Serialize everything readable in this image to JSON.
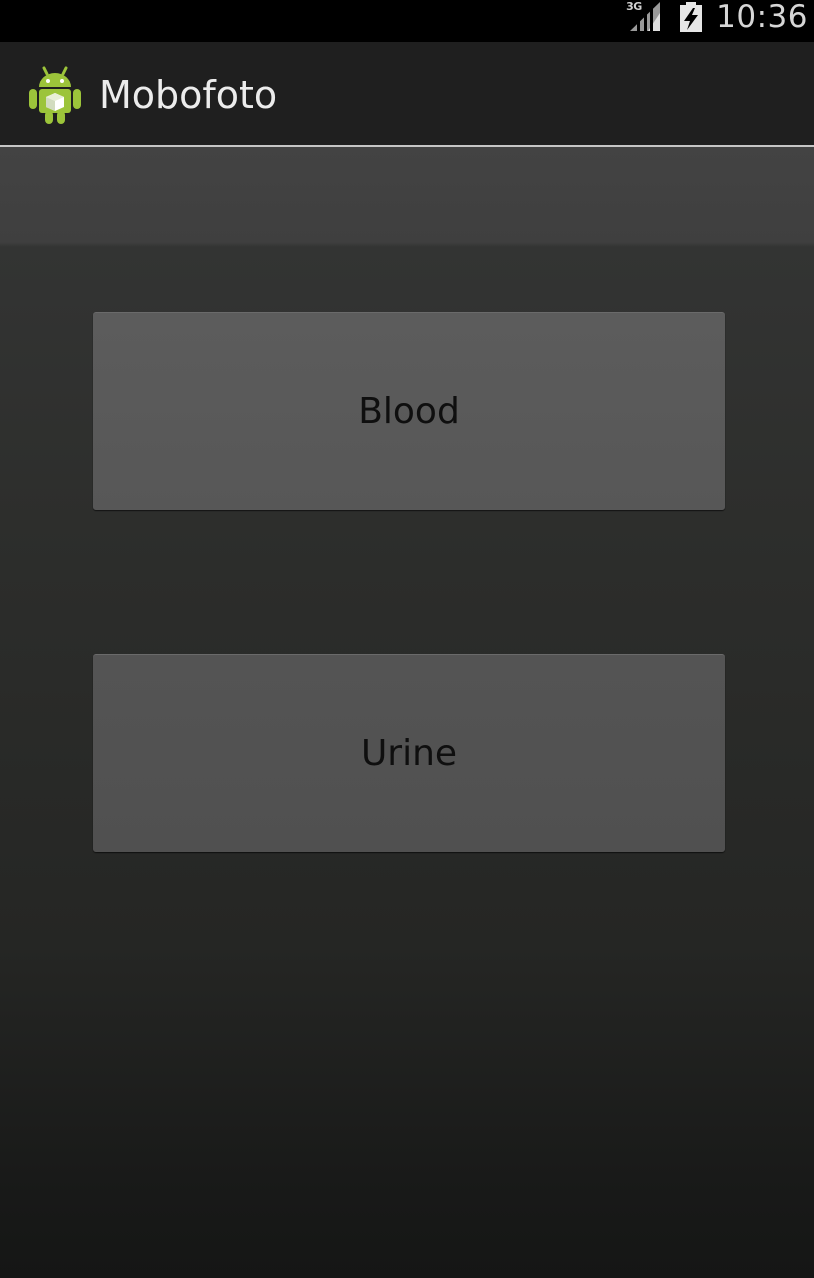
{
  "status_bar": {
    "network_label": "3G",
    "time": "10:36",
    "icons": [
      "signal-icon",
      "battery-charging-icon"
    ]
  },
  "action_bar": {
    "title": "Mobofoto",
    "icon": "android-app-icon"
  },
  "buttons": {
    "blood": "Blood",
    "urine": "Urine"
  },
  "colors": {
    "action_bar_bg": "#1f1f1f",
    "divider": "#c6c6c6",
    "android_green": "#a4c639",
    "button_bg": "#575757"
  }
}
